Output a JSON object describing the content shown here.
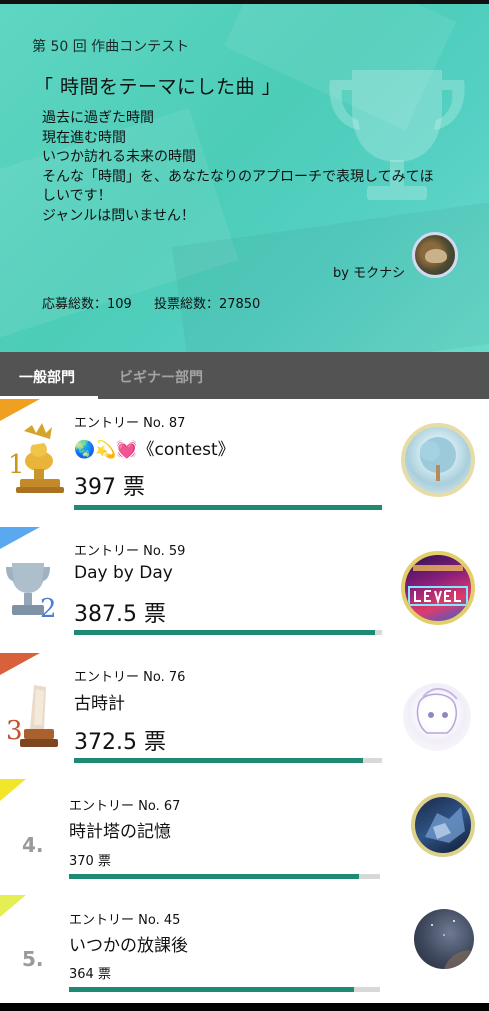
{
  "contest": {
    "subtitle": "第 50 回 作曲コンテスト",
    "title": "「 時間をテーマにした曲 」",
    "description": [
      "過去に過ぎた時間",
      "現在進む時間",
      "いつか訪れる未来の時間",
      "そんな「時間」を、あなたなりのアプローチで表現してみてほ",
      "しいです！",
      "ジャンルは問いません！"
    ],
    "author": "by モクナシ",
    "applications": "応募総数：109",
    "votes_total": "投票総数：27850"
  },
  "tabs": {
    "general": "一般部門",
    "beginner": "ビギナー部門",
    "active": "general"
  },
  "entries": [
    {
      "rank": 1,
      "rank_label": "1",
      "entry_no": "エントリー No. 87",
      "title": "🌏💫💓《contest》",
      "votes": "397 票",
      "vote_value": 397,
      "flag_color": "#f0a020"
    },
    {
      "rank": 2,
      "rank_label": "2",
      "entry_no": "エントリー No. 59",
      "title": "Day by Day",
      "votes": "387.5 票",
      "vote_value": 387.5,
      "flag_color": "#5aa8f0"
    },
    {
      "rank": 3,
      "rank_label": "3",
      "entry_no": "エントリー No. 76",
      "title": "古時計",
      "votes": "372.5 票",
      "vote_value": 372.5,
      "flag_color": "#d8613c"
    },
    {
      "rank": 4,
      "rank_label": "4.",
      "entry_no": "エントリー No. 67",
      "title": "時計塔の記憶",
      "votes": "370 票",
      "vote_value": 370,
      "flag_color": "#f2e52a"
    },
    {
      "rank": 5,
      "rank_label": "5.",
      "entry_no": "エントリー No. 45",
      "title": "いつかの放課後",
      "votes": "364 票",
      "vote_value": 364,
      "flag_color": "#e6ee55"
    }
  ],
  "colors": {
    "bar_fill": "#1f8a73",
    "bar_track": "#d8d8d8",
    "tab_bar": "#535353",
    "hero": "#4ccdb8"
  }
}
